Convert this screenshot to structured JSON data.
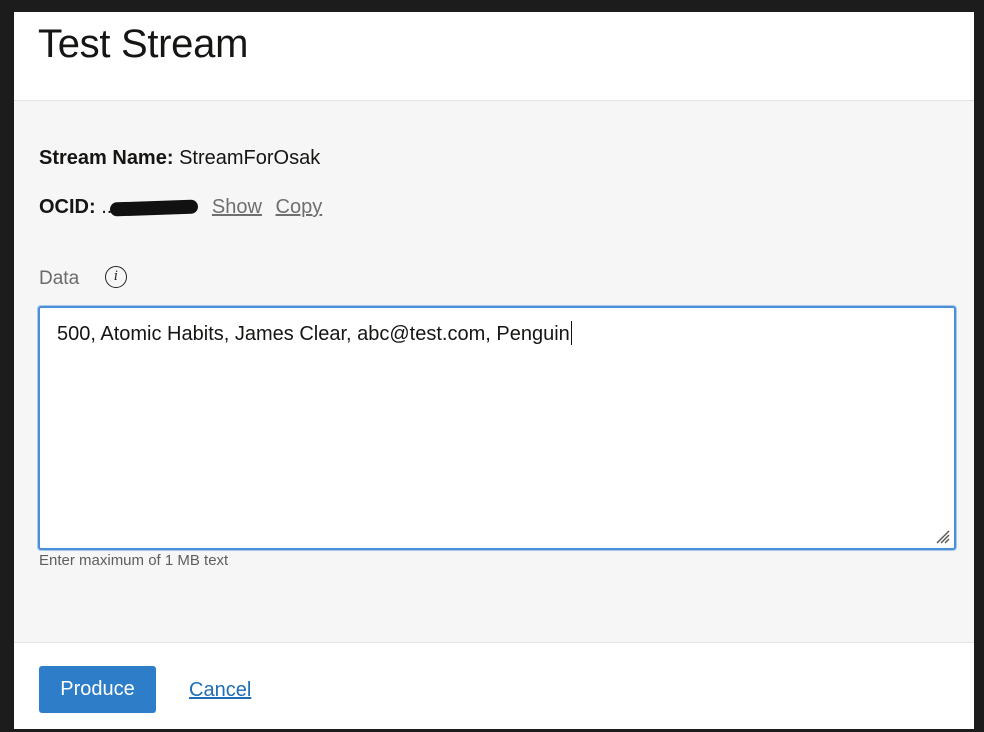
{
  "dialog": {
    "title": "Test Stream"
  },
  "stream": {
    "name_label": "Stream Name:",
    "name_value": "StreamForOsak",
    "ocid_label": "OCID:",
    "ocid_prefix": "..",
    "show_link": "Show",
    "copy_link": "Copy"
  },
  "data_field": {
    "label": "Data",
    "value": "500, Atomic Habits, James Clear, abc@test.com, Penguin",
    "help_text": "Enter maximum of 1 MB text",
    "info_icon": "info-icon"
  },
  "footer": {
    "produce_label": "Produce",
    "cancel_label": "Cancel"
  },
  "colors": {
    "primary_button": "#2d7dc9",
    "link": "#1f6db6",
    "focus_border": "#4a90d9"
  }
}
